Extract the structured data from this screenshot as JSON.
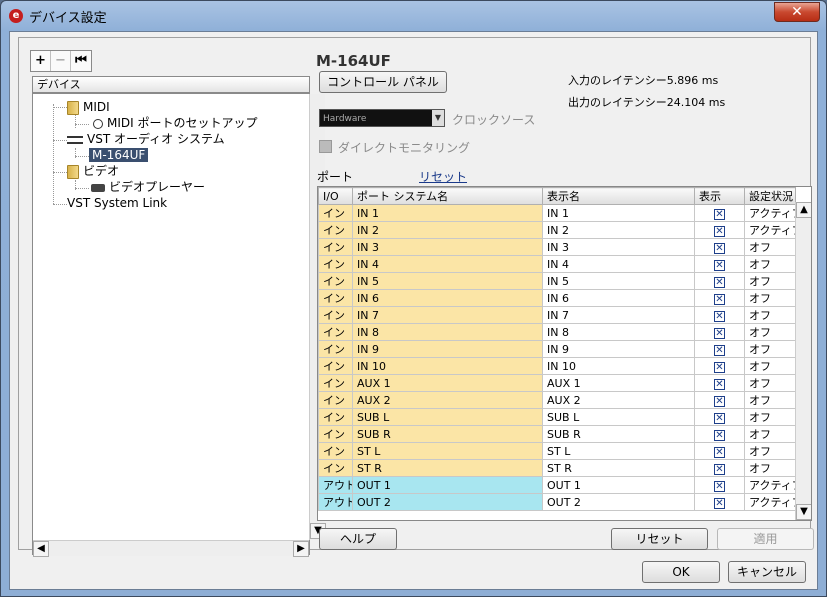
{
  "window": {
    "title": "デバイス設定",
    "close_glyph": "✕"
  },
  "toolbar": {
    "add": "+",
    "remove": "−",
    "reset": "⏮"
  },
  "tree": {
    "header": "デバイス",
    "nodes": [
      {
        "label": "MIDI",
        "icon": "folder-icon"
      },
      {
        "label": "MIDI ポートのセットアップ",
        "icon": "midi-port-icon"
      },
      {
        "label": "VST オーディオ システム",
        "icon": "vst-audio-icon"
      },
      {
        "label": "M-164UF",
        "icon": "none",
        "selected": true
      },
      {
        "label": "ビデオ",
        "icon": "folder-icon"
      },
      {
        "label": "ビデオプレーヤー",
        "icon": "video-player-icon"
      },
      {
        "label": "VST System Link",
        "icon": "none"
      }
    ]
  },
  "device": {
    "name": "M-164UF",
    "control_panel_label": "コントロール パネル",
    "input_latency": "入力のレイテンシー5.896 ms",
    "output_latency": "出力のレイテンシー24.104 ms",
    "clock_source_value": "Hardware",
    "clock_source_label": "クロックソース",
    "direct_monitoring_label": "ダイレクトモニタリング",
    "port_label": "ポート",
    "reset_link": "リセット"
  },
  "ports": {
    "columns": [
      "I/O",
      "ポート システム名",
      "表示名",
      "表示",
      "設定状況"
    ],
    "rows": [
      {
        "io": "イン",
        "port": "IN 1",
        "display": "IN 1",
        "show": "✕",
        "status": "アクティブ",
        "type": "in"
      },
      {
        "io": "イン",
        "port": "IN 2",
        "display": "IN 2",
        "show": "✕",
        "status": "アクティブ",
        "type": "in"
      },
      {
        "io": "イン",
        "port": "IN 3",
        "display": "IN 3",
        "show": "✕",
        "status": "オフ",
        "type": "in"
      },
      {
        "io": "イン",
        "port": "IN 4",
        "display": "IN 4",
        "show": "✕",
        "status": "オフ",
        "type": "in"
      },
      {
        "io": "イン",
        "port": "IN 5",
        "display": "IN 5",
        "show": "✕",
        "status": "オフ",
        "type": "in"
      },
      {
        "io": "イン",
        "port": "IN 6",
        "display": "IN 6",
        "show": "✕",
        "status": "オフ",
        "type": "in"
      },
      {
        "io": "イン",
        "port": "IN 7",
        "display": "IN 7",
        "show": "✕",
        "status": "オフ",
        "type": "in"
      },
      {
        "io": "イン",
        "port": "IN 8",
        "display": "IN 8",
        "show": "✕",
        "status": "オフ",
        "type": "in"
      },
      {
        "io": "イン",
        "port": "IN 9",
        "display": "IN 9",
        "show": "✕",
        "status": "オフ",
        "type": "in"
      },
      {
        "io": "イン",
        "port": "IN 10",
        "display": "IN 10",
        "show": "✕",
        "status": "オフ",
        "type": "in"
      },
      {
        "io": "イン",
        "port": "AUX 1",
        "display": "AUX 1",
        "show": "✕",
        "status": "オフ",
        "type": "in"
      },
      {
        "io": "イン",
        "port": "AUX 2",
        "display": "AUX 2",
        "show": "✕",
        "status": "オフ",
        "type": "in"
      },
      {
        "io": "イン",
        "port": "SUB L",
        "display": "SUB L",
        "show": "✕",
        "status": "オフ",
        "type": "in"
      },
      {
        "io": "イン",
        "port": "SUB R",
        "display": "SUB R",
        "show": "✕",
        "status": "オフ",
        "type": "in"
      },
      {
        "io": "イン",
        "port": "ST L",
        "display": "ST L",
        "show": "✕",
        "status": "オフ",
        "type": "in"
      },
      {
        "io": "イン",
        "port": "ST R",
        "display": "ST R",
        "show": "✕",
        "status": "オフ",
        "type": "in"
      },
      {
        "io": "アウト",
        "port": "OUT 1",
        "display": "OUT 1",
        "show": "✕",
        "status": "アクティブ",
        "type": "out"
      },
      {
        "io": "アウト",
        "port": "OUT 2",
        "display": "OUT 2",
        "show": "✕",
        "status": "アクティブ",
        "type": "out"
      }
    ]
  },
  "buttons": {
    "help": "ヘルプ",
    "reset": "リセット",
    "apply": "適用",
    "ok": "OK",
    "cancel": "キャンセル"
  },
  "scroll": {
    "up": "▲",
    "down": "▼",
    "left": "◀",
    "right": "▶"
  }
}
